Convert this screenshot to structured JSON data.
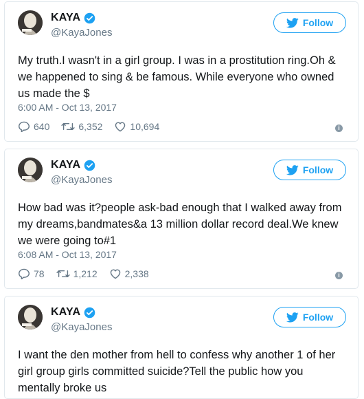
{
  "tweets": [
    {
      "name": "KAYA",
      "handle": "@KayaJones",
      "follow_label": "Follow",
      "text": "My truth.I wasn't in a girl group. I was in a prostitution ring.Oh & we happened to sing & be famous. While everyone who owned us made the $",
      "timestamp": "6:00 AM - Oct 13, 2017",
      "replies": "640",
      "retweets": "6,352",
      "likes": "10,694"
    },
    {
      "name": "KAYA",
      "handle": "@KayaJones",
      "follow_label": "Follow",
      "text": "How bad was it?people ask-bad enough that I walked away from my dreams,bandmates&a 13 million dollar record deal.We knew we were going to#1",
      "timestamp": "6:08 AM - Oct 13, 2017",
      "replies": "78",
      "retweets": "1,212",
      "likes": "2,338"
    },
    {
      "name": "KAYA",
      "handle": "@KayaJones",
      "follow_label": "Follow",
      "text": "I want the den mother from hell to confess why another 1 of her girl group girls committed suicide?Tell the public how you mentally broke us"
    }
  ],
  "icons": {
    "verified": "verified-badge-icon",
    "bird": "twitter-bird-icon",
    "reply": "reply-icon",
    "retweet": "retweet-icon",
    "like": "heart-icon",
    "info": "info-icon"
  },
  "colors": {
    "accent": "#1da1f2",
    "muted": "#657786",
    "border": "#e1e8ed"
  }
}
